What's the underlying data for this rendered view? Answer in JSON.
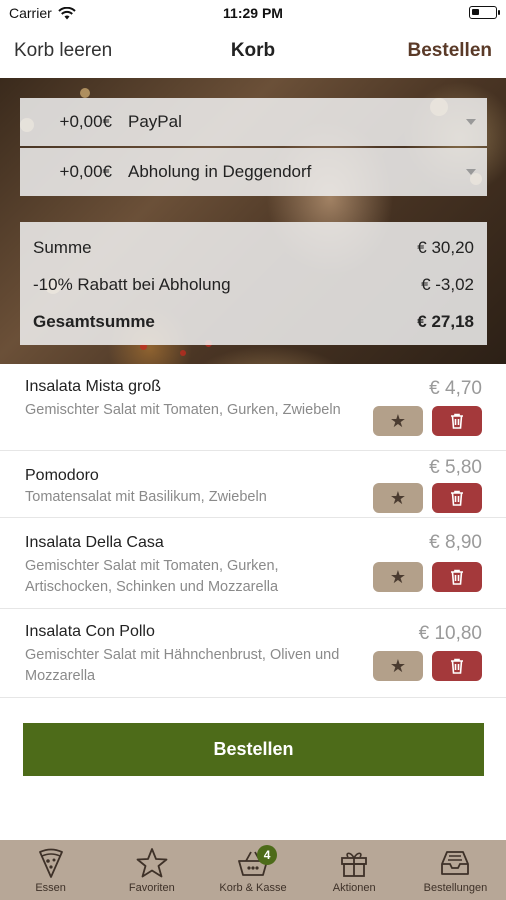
{
  "status": {
    "carrier": "Carrier",
    "time": "11:29 PM"
  },
  "nav": {
    "left": "Korb leeren",
    "title": "Korb",
    "right": "Bestellen"
  },
  "payment": {
    "price": "+0,00€",
    "label": "PayPal"
  },
  "delivery": {
    "price": "+0,00€",
    "label": "Abholung in Deggendorf"
  },
  "summary": [
    {
      "label": "Summe",
      "value": "€ 30,20"
    },
    {
      "label": "-10% Rabatt bei Abholung",
      "value": "€ -3,02"
    },
    {
      "label": "Gesamtsumme",
      "value": "€ 27,18"
    }
  ],
  "items": [
    {
      "name": "Insalata Mista groß",
      "desc": "Gemischter Salat mit Tomaten, Gurken, Zwiebeln",
      "price": "€ 4,70"
    },
    {
      "name": "Pomodoro",
      "desc": "Tomatensalat mit Basilikum, Zwiebeln",
      "price": "€ 5,80"
    },
    {
      "name": "Insalata Della Casa",
      "desc": "Gemischter Salat mit Tomaten, Gurken, Artischocken, Schinken und Mozzarella",
      "price": "€ 8,90"
    },
    {
      "name": "Insalata Con Pollo",
      "desc": "Gemischter Salat mit Hähnchenbrust, Oliven und Mozzarella",
      "price": "€ 10,80"
    }
  ],
  "order_button": "Bestellen",
  "tabs": [
    {
      "label": "Essen",
      "icon": "pizza-slice-icon"
    },
    {
      "label": "Favoriten",
      "icon": "star-icon"
    },
    {
      "label": "Korb & Kasse",
      "icon": "basket-icon",
      "badge": "4"
    },
    {
      "label": "Aktionen",
      "icon": "gift-icon"
    },
    {
      "label": "Bestellungen",
      "icon": "inbox-tray-icon"
    }
  ],
  "colors": {
    "accent_green": "#4d6b19",
    "brand_brown": "#5a3a28",
    "delete_red": "#a4393b",
    "fav_tan": "#b3a08a",
    "tabbar": "#b7a797"
  }
}
